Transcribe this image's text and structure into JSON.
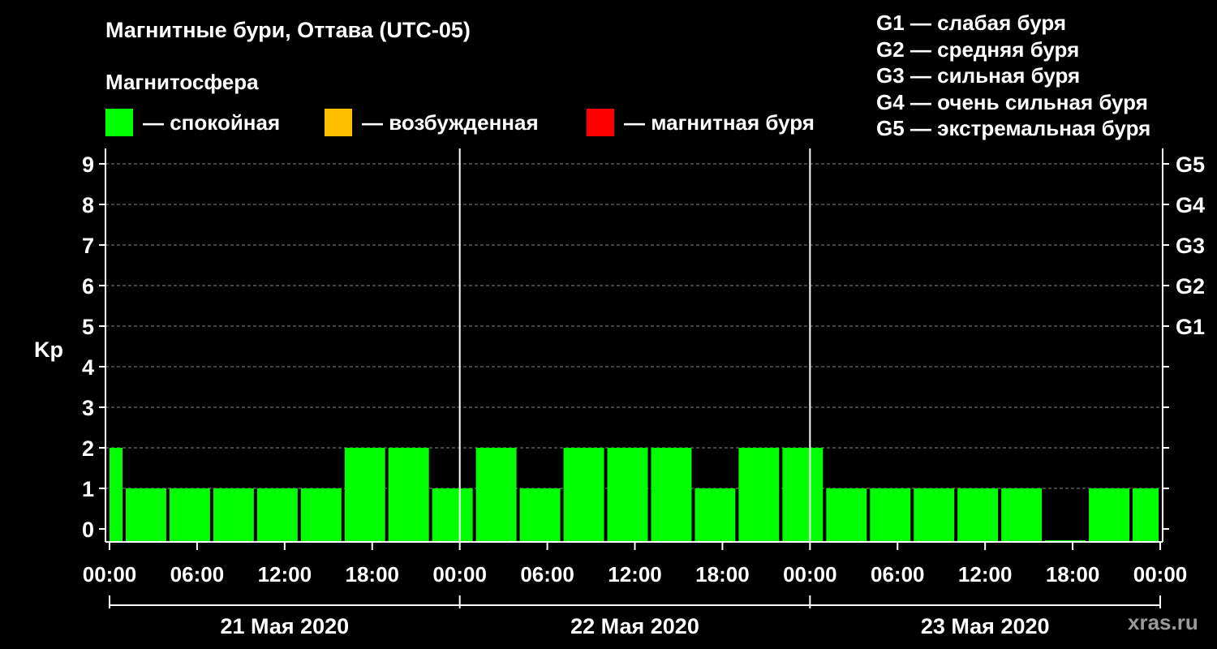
{
  "header": {
    "title": "Магнитные бури, Оттава (UTC-05)",
    "subtitle": "Магнитосфера"
  },
  "legend": [
    {
      "label": "— спокойная",
      "color": "#00ff00"
    },
    {
      "label": "— возбужденная",
      "color": "#ffbf00"
    },
    {
      "label": "— магнитная буря",
      "color": "#ff0000"
    }
  ],
  "g_legend": [
    "G1 — слабая буря",
    "G2 — средняя буря",
    "G3 — сильная буря",
    "G4 — очень сильная буря",
    "G5 — экстремальная буря"
  ],
  "watermark": "xras.ru",
  "chart_data": {
    "type": "bar",
    "ylabel": "Kp",
    "ylim": [
      0,
      9
    ],
    "yticks": [
      "0",
      "1",
      "2",
      "3",
      "4",
      "5",
      "6",
      "7",
      "8",
      "9"
    ],
    "g_levels": [
      {
        "label": "G1",
        "kp": 5
      },
      {
        "label": "G2",
        "kp": 6
      },
      {
        "label": "G3",
        "kp": 7
      },
      {
        "label": "G4",
        "kp": 8
      },
      {
        "label": "G5",
        "kp": 9
      }
    ],
    "x_ticks": [
      "00:00",
      "06:00",
      "12:00",
      "18:00",
      "00:00",
      "06:00",
      "12:00",
      "18:00",
      "00:00",
      "06:00",
      "12:00",
      "18:00",
      "00:00"
    ],
    "days": [
      "21 Мая 2020",
      "22 Мая 2020",
      "23 Мая 2020"
    ],
    "grid": true,
    "bar_color": "#00ff00",
    "bars": [
      {
        "start_hour": 0,
        "end_hour": 1,
        "kp": 2
      },
      {
        "start_hour": 1,
        "end_hour": 4,
        "kp": 1
      },
      {
        "start_hour": 4,
        "end_hour": 7,
        "kp": 1
      },
      {
        "start_hour": 7,
        "end_hour": 10,
        "kp": 1
      },
      {
        "start_hour": 10,
        "end_hour": 13,
        "kp": 1
      },
      {
        "start_hour": 13,
        "end_hour": 16,
        "kp": 1
      },
      {
        "start_hour": 16,
        "end_hour": 19,
        "kp": 2
      },
      {
        "start_hour": 19,
        "end_hour": 22,
        "kp": 2
      },
      {
        "start_hour": 22,
        "end_hour": 25,
        "kp": 1
      },
      {
        "start_hour": 25,
        "end_hour": 28,
        "kp": 2
      },
      {
        "start_hour": 28,
        "end_hour": 31,
        "kp": 1
      },
      {
        "start_hour": 31,
        "end_hour": 34,
        "kp": 2
      },
      {
        "start_hour": 34,
        "end_hour": 37,
        "kp": 2
      },
      {
        "start_hour": 37,
        "end_hour": 40,
        "kp": 2
      },
      {
        "start_hour": 40,
        "end_hour": 43,
        "kp": 1
      },
      {
        "start_hour": 43,
        "end_hour": 46,
        "kp": 2
      },
      {
        "start_hour": 46,
        "end_hour": 49,
        "kp": 2
      },
      {
        "start_hour": 49,
        "end_hour": 52,
        "kp": 1
      },
      {
        "start_hour": 52,
        "end_hour": 55,
        "kp": 1
      },
      {
        "start_hour": 55,
        "end_hour": 58,
        "kp": 1
      },
      {
        "start_hour": 58,
        "end_hour": 61,
        "kp": 1
      },
      {
        "start_hour": 61,
        "end_hour": 64,
        "kp": 1
      },
      {
        "start_hour": 64,
        "end_hour": 67,
        "kp": 0
      },
      {
        "start_hour": 67,
        "end_hour": 70,
        "kp": 1
      },
      {
        "start_hour": 70,
        "end_hour": 72,
        "kp": 1
      }
    ]
  }
}
